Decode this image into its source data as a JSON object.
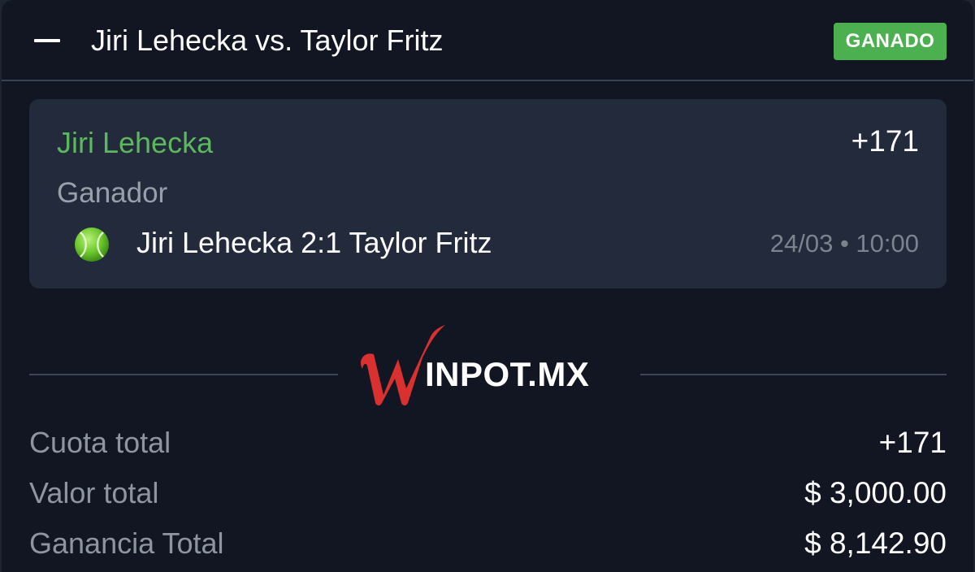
{
  "header": {
    "title": "Jiri Lehecka vs. Taylor Fritz",
    "status": "GANADO",
    "status_color": "#4caf50",
    "collapse_icon": "minus-icon"
  },
  "selection": {
    "name": "Jiri Lehecka",
    "odds": "+171",
    "market": "Ganador",
    "sport_icon": "tennis-ball-icon",
    "result": "Jiri Lehecka 2:1 Taylor Fritz",
    "datetime": "24/03 • 10:00"
  },
  "brand": {
    "logo_letter": "W",
    "logo_text": "INPOT.MX"
  },
  "summary": {
    "odds_label": "Cuota total",
    "odds_value": "+171",
    "stake_label": "Valor total",
    "stake_value": "$ 3,000.00",
    "payout_label": "Ganancia Total",
    "payout_value": "$ 8,142.90"
  },
  "colors": {
    "background": "#111622",
    "panel": "#222a3c",
    "accent_green": "#5cb85c",
    "brand_red": "#d8312f"
  }
}
